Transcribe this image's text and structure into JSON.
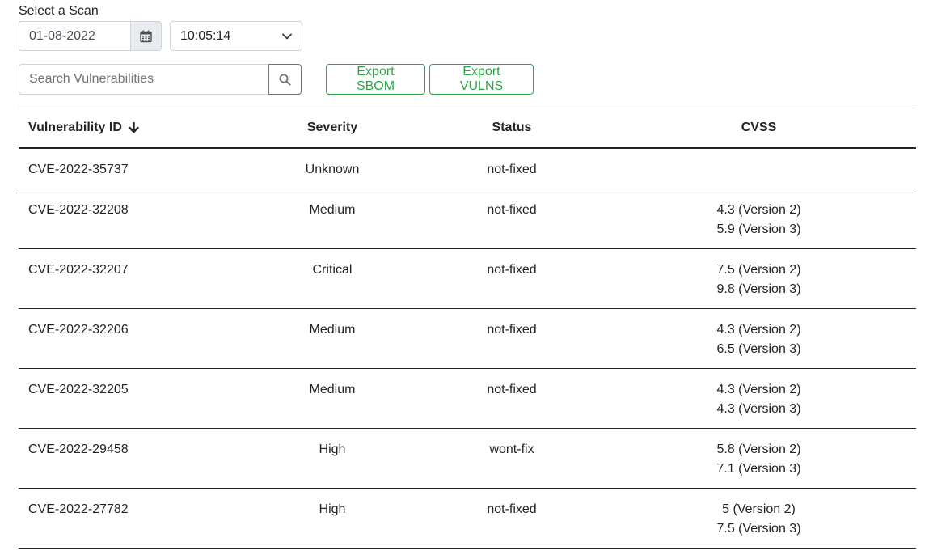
{
  "scan": {
    "label": "Select a Scan",
    "date_value": "01-08-2022",
    "time_value": "10:05:14"
  },
  "search": {
    "placeholder": "Search Vulnerabilities"
  },
  "exports": {
    "sbom_label": "Export SBOM",
    "vulns_label": "Export VULNS"
  },
  "table": {
    "headers": {
      "id": "Vulnerability ID",
      "severity": "Severity",
      "status": "Status",
      "cvss": "CVSS"
    },
    "rows": [
      {
        "id": "CVE-2022-35737",
        "severity": "Unknown",
        "status": "not-fixed",
        "cvss_v2": "",
        "cvss_v3": ""
      },
      {
        "id": "CVE-2022-32208",
        "severity": "Medium",
        "status": "not-fixed",
        "cvss_v2": "4.3 (Version 2)",
        "cvss_v3": "5.9 (Version 3)"
      },
      {
        "id": "CVE-2022-32207",
        "severity": "Critical",
        "status": "not-fixed",
        "cvss_v2": "7.5 (Version 2)",
        "cvss_v3": "9.8 (Version 3)"
      },
      {
        "id": "CVE-2022-32206",
        "severity": "Medium",
        "status": "not-fixed",
        "cvss_v2": "4.3 (Version 2)",
        "cvss_v3": "6.5 (Version 3)"
      },
      {
        "id": "CVE-2022-32205",
        "severity": "Medium",
        "status": "not-fixed",
        "cvss_v2": "4.3 (Version 2)",
        "cvss_v3": "4.3 (Version 3)"
      },
      {
        "id": "CVE-2022-29458",
        "severity": "High",
        "status": "wont-fix",
        "cvss_v2": "5.8 (Version 2)",
        "cvss_v3": "7.1 (Version 3)"
      },
      {
        "id": "CVE-2022-27782",
        "severity": "High",
        "status": "not-fixed",
        "cvss_v2": "5 (Version 2)",
        "cvss_v3": "7.5 (Version 3)"
      }
    ]
  },
  "icons": {
    "calendar": "calendar-icon",
    "chevron": "chevron-down-icon",
    "search": "search-icon",
    "sort": "arrow-down-icon"
  },
  "colors": {
    "accent_green": "#28a745",
    "text": "#212529",
    "border": "#ced4da"
  }
}
